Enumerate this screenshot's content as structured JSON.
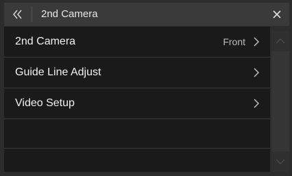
{
  "header": {
    "title": "2nd Camera",
    "back_icon": "double-chevron-left-icon",
    "close_icon": "close-icon"
  },
  "menu": {
    "items": [
      {
        "label": "2nd Camera",
        "value": "Front"
      },
      {
        "label": "Guide Line Adjust",
        "value": ""
      },
      {
        "label": "Video Setup",
        "value": ""
      }
    ]
  },
  "scrollbar": {
    "up_icon": "chevron-up-icon",
    "down_icon": "chevron-down-icon"
  },
  "colors": {
    "background": "#2c2c2c",
    "list_background": "#1a1a1a",
    "text": "#f2f2f2",
    "secondary_text": "#bdbdbd"
  }
}
